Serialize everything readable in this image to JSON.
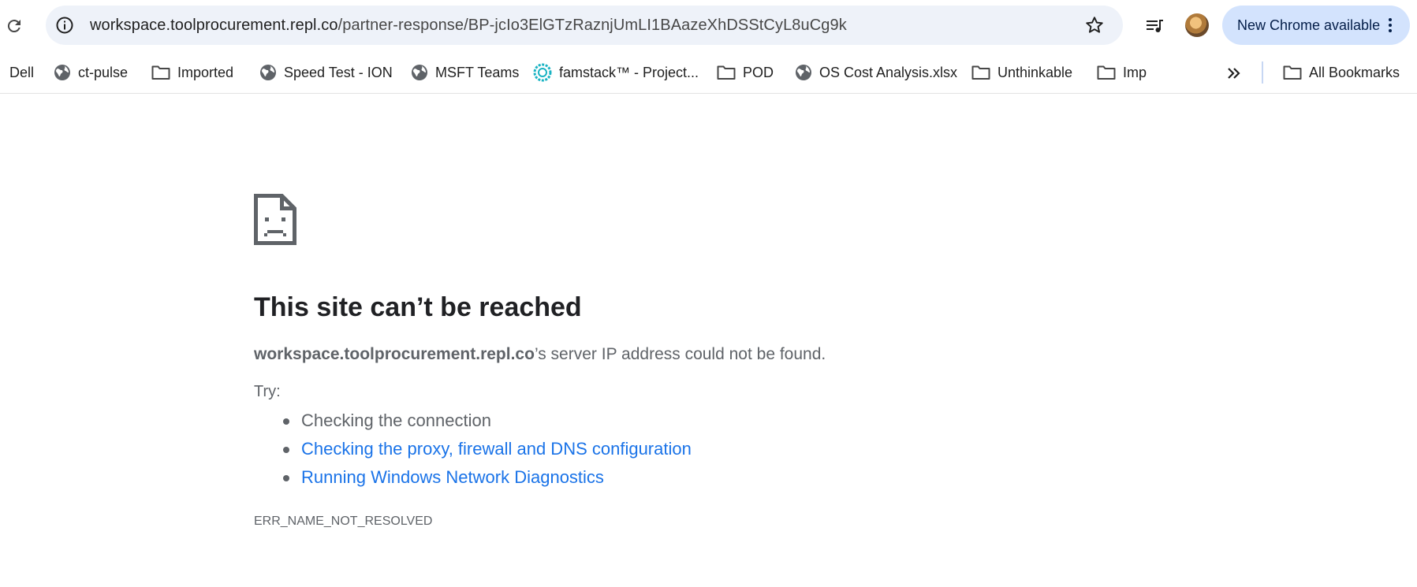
{
  "toolbar": {
    "url_host": "workspace.toolprocurement.repl.co",
    "url_path": "/partner-response/BP-jcIo3ElGTzRaznjUmLI1BAazeXhDSStCyL8uCg9k",
    "update_label": "New Chrome available",
    "icons": {
      "reload": "reload-icon",
      "site_info": "site-info-icon",
      "bookmark_star": "star-icon",
      "media": "media-controls-icon",
      "menu": "kebab-menu-icon"
    }
  },
  "bookmarks": [
    {
      "label": "Dell",
      "icon": "none"
    },
    {
      "label": "ct-pulse",
      "icon": "globe"
    },
    {
      "label": "Imported",
      "icon": "folder"
    },
    {
      "label": "Speed Test - ION",
      "icon": "globe"
    },
    {
      "label": "MSFT Teams",
      "icon": "globe"
    },
    {
      "label": "famstack™ - Project...",
      "icon": "famstack"
    },
    {
      "label": "POD",
      "icon": "folder"
    },
    {
      "label": "OS Cost Analysis.xlsx",
      "icon": "globe"
    },
    {
      "label": "Unthinkable",
      "icon": "folder"
    },
    {
      "label": "Imp",
      "icon": "folder"
    }
  ],
  "all_bookmarks_label": "All Bookmarks",
  "error": {
    "title": "This site can’t be reached",
    "host": "workspace.toolprocurement.repl.co",
    "message_suffix": "’s server IP address could not be found.",
    "try_label": "Try:",
    "suggestions": [
      {
        "text": "Checking the connection",
        "link": false
      },
      {
        "text": "Checking the proxy, firewall and DNS configuration",
        "link": true
      },
      {
        "text": "Running Windows Network Diagnostics",
        "link": true
      }
    ],
    "code": "ERR_NAME_NOT_RESOLVED"
  },
  "colors": {
    "omnibox_bg": "#eef2f9",
    "update_pill_bg": "#d3e3fd",
    "link": "#1a73e8",
    "body_text": "#5f6368",
    "title_text": "#202124"
  }
}
